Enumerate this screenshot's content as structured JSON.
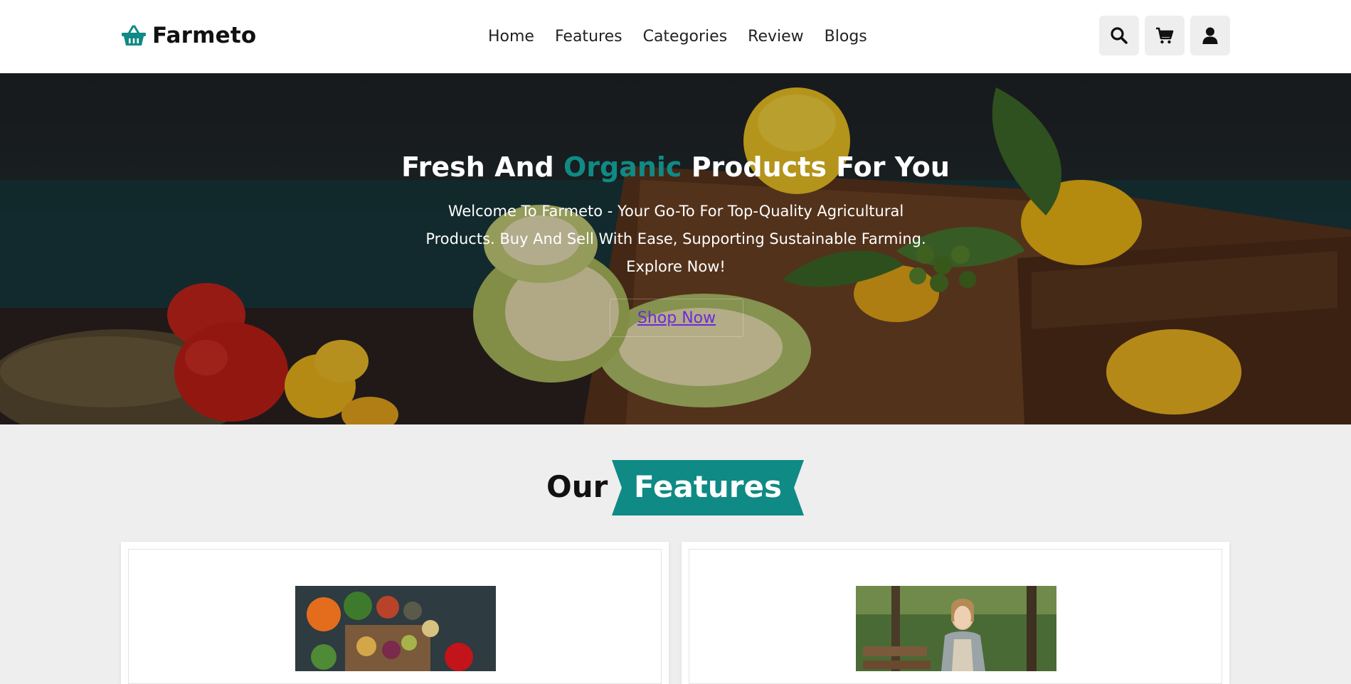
{
  "brand": {
    "name": "Farmeto",
    "icon": "basket-icon",
    "accent": "#0f8a85"
  },
  "nav": {
    "items": [
      "Home",
      "Features",
      "Categories",
      "Review",
      "Blogs"
    ]
  },
  "header_icons": [
    "search-icon",
    "cart-icon",
    "user-icon"
  ],
  "hero": {
    "title_part1": "Fresh And",
    "title_accent": "Organic",
    "title_part2": "Products For You",
    "text": "Welcome To Farmeto - Your Go-To For Top-Quality Agricultural Products. Buy And Sell With Ease, Supporting Sustainable Farming. Explore Now!",
    "button": "Shop Now"
  },
  "features": {
    "heading_plain": "Our",
    "heading_highlight": "Features"
  }
}
